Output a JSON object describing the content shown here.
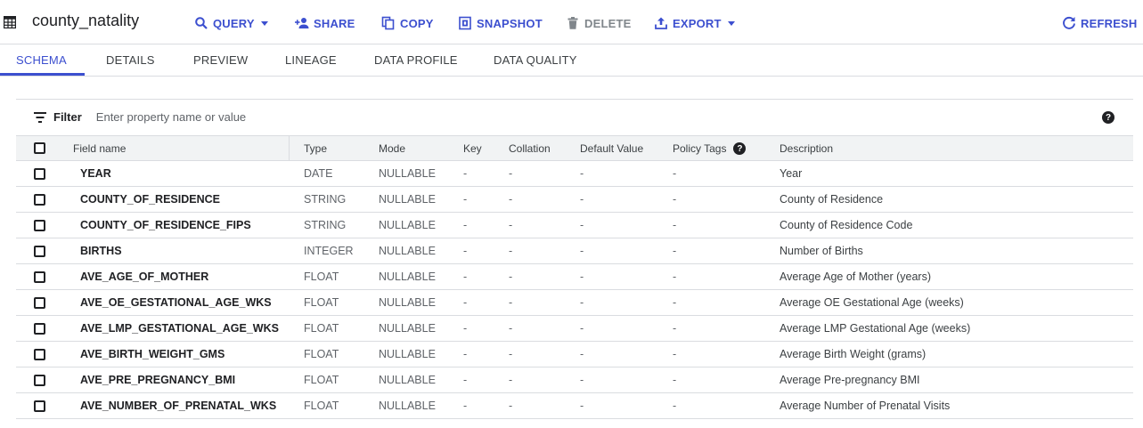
{
  "header": {
    "title": "county_natality",
    "actions": {
      "query": "QUERY",
      "share": "SHARE",
      "copy": "COPY",
      "snapshot": "SNAPSHOT",
      "delete": "DELETE",
      "export": "EXPORT",
      "refresh": "REFRESH"
    }
  },
  "tabs": [
    "SCHEMA",
    "DETAILS",
    "PREVIEW",
    "LINEAGE",
    "DATA PROFILE",
    "DATA QUALITY"
  ],
  "active_tab": "SCHEMA",
  "filter": {
    "label": "Filter",
    "placeholder": "Enter property name or value"
  },
  "table": {
    "columns": [
      "Field name",
      "Type",
      "Mode",
      "Key",
      "Collation",
      "Default Value",
      "Policy Tags",
      "Description"
    ],
    "rows": [
      {
        "name": "YEAR",
        "type": "DATE",
        "mode": "NULLABLE",
        "key": "-",
        "collation": "-",
        "default": "-",
        "policy": "-",
        "desc": "Year"
      },
      {
        "name": "COUNTY_OF_RESIDENCE",
        "type": "STRING",
        "mode": "NULLABLE",
        "key": "-",
        "collation": "-",
        "default": "-",
        "policy": "-",
        "desc": "County of Residence"
      },
      {
        "name": "COUNTY_OF_RESIDENCE_FIPS",
        "type": "STRING",
        "mode": "NULLABLE",
        "key": "-",
        "collation": "-",
        "default": "-",
        "policy": "-",
        "desc": "County of Residence Code"
      },
      {
        "name": "BIRTHS",
        "type": "INTEGER",
        "mode": "NULLABLE",
        "key": "-",
        "collation": "-",
        "default": "-",
        "policy": "-",
        "desc": "Number of Births"
      },
      {
        "name": "AVE_AGE_OF_MOTHER",
        "type": "FLOAT",
        "mode": "NULLABLE",
        "key": "-",
        "collation": "-",
        "default": "-",
        "policy": "-",
        "desc": "Average Age of Mother (years)"
      },
      {
        "name": "AVE_OE_GESTATIONAL_AGE_WKS",
        "type": "FLOAT",
        "mode": "NULLABLE",
        "key": "-",
        "collation": "-",
        "default": "-",
        "policy": "-",
        "desc": "Average OE Gestational Age (weeks)"
      },
      {
        "name": "AVE_LMP_GESTATIONAL_AGE_WKS",
        "type": "FLOAT",
        "mode": "NULLABLE",
        "key": "-",
        "collation": "-",
        "default": "-",
        "policy": "-",
        "desc": "Average LMP Gestational Age (weeks)"
      },
      {
        "name": "AVE_BIRTH_WEIGHT_GMS",
        "type": "FLOAT",
        "mode": "NULLABLE",
        "key": "-",
        "collation": "-",
        "default": "-",
        "policy": "-",
        "desc": "Average Birth Weight (grams)"
      },
      {
        "name": "AVE_PRE_PREGNANCY_BMI",
        "type": "FLOAT",
        "mode": "NULLABLE",
        "key": "-",
        "collation": "-",
        "default": "-",
        "policy": "-",
        "desc": "Average Pre-pregnancy BMI"
      },
      {
        "name": "AVE_NUMBER_OF_PRENATAL_WKS",
        "type": "FLOAT",
        "mode": "NULLABLE",
        "key": "-",
        "collation": "-",
        "default": "-",
        "policy": "-",
        "desc": "Average Number of Prenatal Visits"
      }
    ]
  },
  "icons": {
    "table": "table-icon",
    "query": "search-icon",
    "share": "person-add-icon",
    "copy": "copy-icon",
    "snapshot": "snapshot-icon",
    "delete": "trash-icon",
    "export": "upload-icon",
    "refresh": "refresh-icon",
    "filter": "filter-icon",
    "help": "help-icon"
  },
  "colors": {
    "accent": "#3c4fcf",
    "disabled": "#80868b",
    "header_bg": "#f1f3f4",
    "border": "#dadce0"
  }
}
